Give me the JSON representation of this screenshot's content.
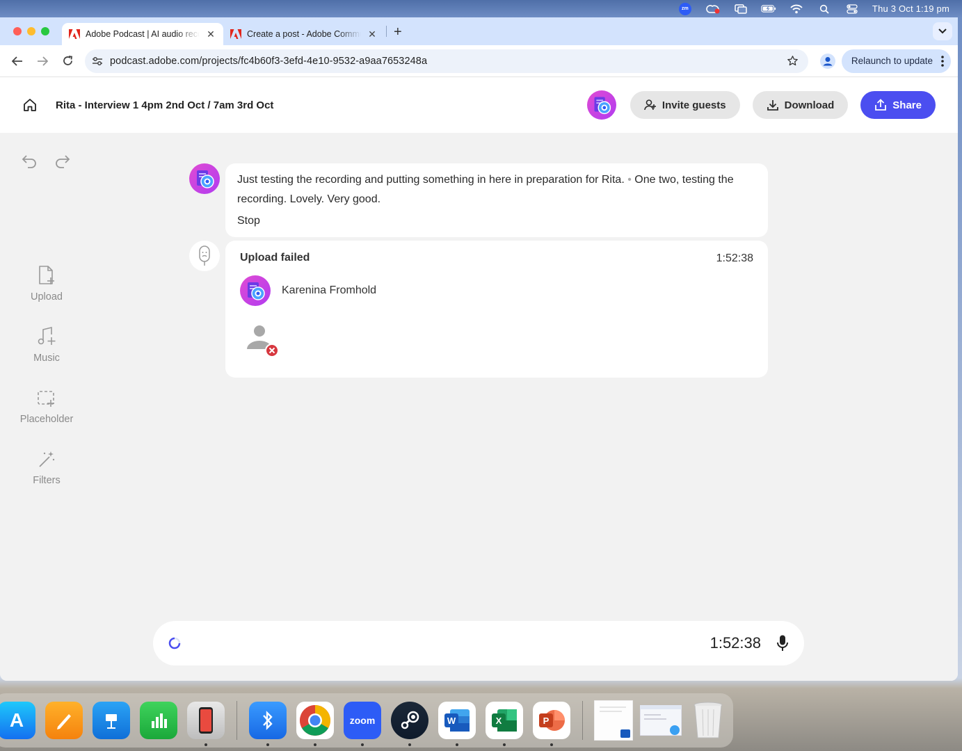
{
  "menubar": {
    "zoom_badge": "zm",
    "clock": "Thu 3 Oct  1:19 pm"
  },
  "browser": {
    "tabs": [
      {
        "title": "Adobe Podcast | AI audio recording",
        "active": true
      },
      {
        "title": "Create a post - Adobe Community",
        "active": false
      }
    ],
    "url": "podcast.adobe.com/projects/fc4b60f3-3efd-4e10-9532-a9aa7653248a",
    "relaunch_label": "Relaunch to update"
  },
  "app": {
    "project_title": "Rita - Interview 1 4pm 2nd Oct / 7am 3rd Oct",
    "actions": {
      "invite": "Invite guests",
      "download": "Download",
      "share": "Share"
    },
    "sidebar": [
      {
        "label": "Upload",
        "icon": "upload-icon"
      },
      {
        "label": "Music",
        "icon": "music-icon"
      },
      {
        "label": "Placeholder",
        "icon": "placeholder-icon"
      },
      {
        "label": "Filters",
        "icon": "filters-icon"
      }
    ],
    "transcript": {
      "text_part1": " Just testing the recording and putting something in here in preparation for Rita.",
      "text_part2": "One two, testing the recording. Lovely. Very good.",
      "stop": "Stop"
    },
    "upload": {
      "title": "Upload failed",
      "time": "1:52:38",
      "guest_name": "Karenina Fromhold"
    },
    "player": {
      "time": "1:52:38"
    }
  },
  "colors": {
    "accent": "#4b4ef0",
    "error": "#d7373f",
    "avatar_gradient_a": "#d94bd6",
    "avatar_gradient_b": "#3b7bf0"
  }
}
